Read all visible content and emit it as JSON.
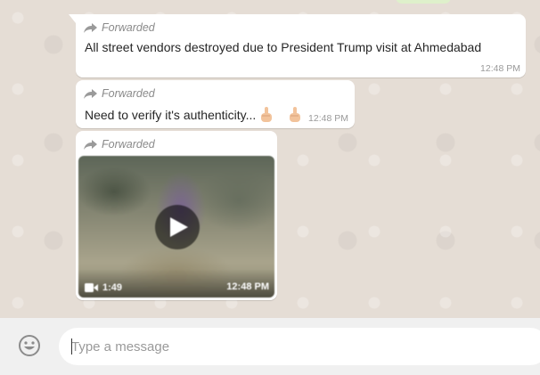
{
  "chat": {
    "messages": [
      {
        "forwarded_label": "Forwarded",
        "text": "All street vendors destroyed due to President Trump visit at Ahmedabad",
        "time": "12:48 PM"
      },
      {
        "forwarded_label": "Forwarded",
        "text": "Need to verify it's authenticity...",
        "emoji": "pointing-up-hand x2",
        "time": "12:48 PM"
      },
      {
        "forwarded_label": "Forwarded",
        "type": "video",
        "duration": "1:49",
        "time": "12:48 PM"
      }
    ]
  },
  "composer": {
    "placeholder": "Type a message",
    "emoji_icon": "smiley-icon"
  },
  "colors": {
    "chat_background": "#e5ddd5",
    "bubble": "#ffffff",
    "footer": "#f0f0f0",
    "meta_text": "#9a9a9a"
  }
}
